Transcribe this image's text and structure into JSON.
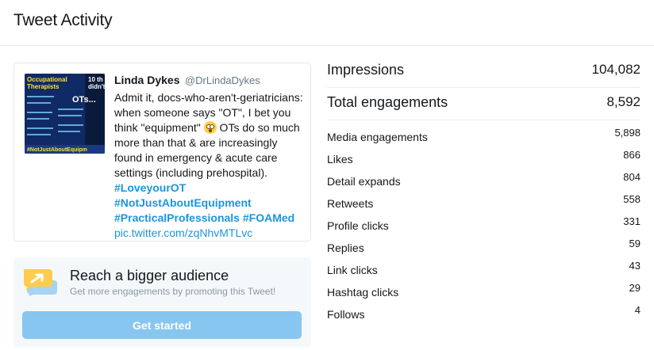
{
  "header": {
    "title": "Tweet Activity"
  },
  "tweet": {
    "image": {
      "title_left": "Occupational Therapists",
      "title_right": "10 th didn't",
      "center_label": "OTs...",
      "hashtag": "#NotJustAboutEquipm"
    },
    "author_name": "Linda Dykes",
    "author_handle": "@DrLindaDykes",
    "text_part1": "Admit it, docs-who-aren't-geriatricians: when someone says \"OT\", I bet you think \"equipment\" ",
    "text_part2": " OTs do so much more than that & are increasingly found in emergency & acute care settings (including prehospital). ",
    "hashtags": [
      "#LoveyourOT",
      "#NotJustAboutEquipment",
      "#PracticalProfessionals",
      "#FOAMed"
    ],
    "url": "pic.twitter.com/zqNhvMTLvc"
  },
  "promo": {
    "title": "Reach a bigger audience",
    "subtitle": "Get more engagements by promoting this Tweet!",
    "button_label": "Get started",
    "icon": "megaphone-chat-icon"
  },
  "stats": {
    "impressions": {
      "label": "Impressions",
      "value": "104,082"
    },
    "total_engagements": {
      "label": "Total engagements",
      "value": "8,592"
    },
    "rows": [
      {
        "label": "Media engagements",
        "value": "5,898"
      },
      {
        "label": "Likes",
        "value": "866"
      },
      {
        "label": "Detail expands",
        "value": "804"
      },
      {
        "label": "Retweets",
        "value": "558"
      },
      {
        "label": "Profile clicks",
        "value": "331"
      },
      {
        "label": "Replies",
        "value": "59"
      },
      {
        "label": "Link clicks",
        "value": "43"
      },
      {
        "label": "Hashtag clicks",
        "value": "29"
      },
      {
        "label": "Follows",
        "value": "4"
      }
    ]
  },
  "colors": {
    "link": "#1b95e0",
    "button": "#87c6f0",
    "promo_bg": "#f5f8fa",
    "border": "#e1e8ed"
  }
}
